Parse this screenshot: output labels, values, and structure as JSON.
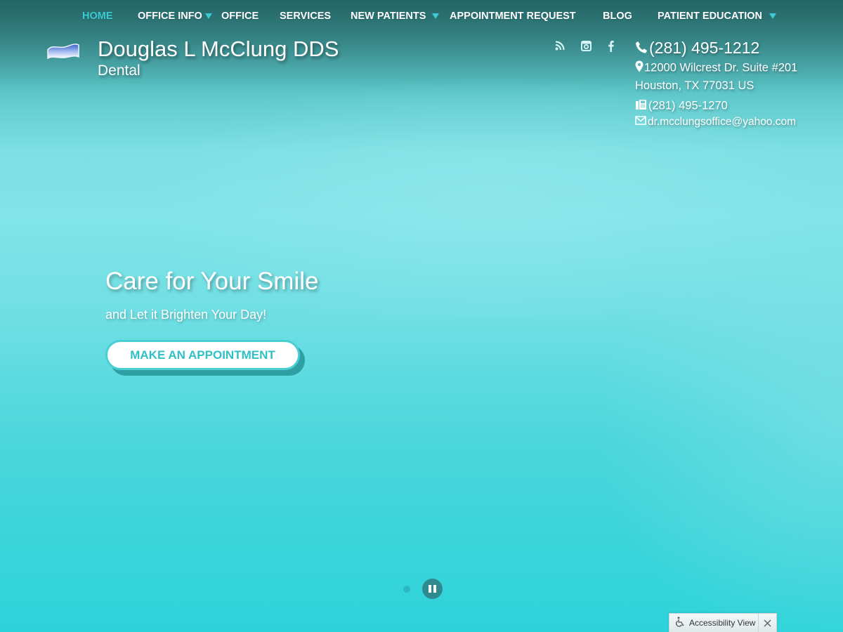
{
  "nav": {
    "items": [
      {
        "label": "HOME",
        "active": true,
        "has_dropdown": false
      },
      {
        "label": "OFFICE INFO",
        "active": false,
        "has_dropdown": true
      },
      {
        "label": "OFFICE",
        "active": false,
        "has_dropdown": false
      },
      {
        "label": "SERVICES",
        "active": false,
        "has_dropdown": false
      },
      {
        "label": "NEW PATIENTS",
        "active": false,
        "has_dropdown": true
      },
      {
        "label": "APPOINTMENT REQUEST",
        "active": false,
        "has_dropdown": false
      },
      {
        "label": "BLOG",
        "active": false,
        "has_dropdown": false
      },
      {
        "label": "PATIENT EDUCATION",
        "active": false,
        "has_dropdown": true
      }
    ]
  },
  "brand": {
    "logo_icon": "tooth-wave-logo",
    "name": "Douglas L McClung DDS",
    "subtitle": "Dental"
  },
  "social": [
    {
      "name": "rss-icon"
    },
    {
      "name": "instagram-icon"
    },
    {
      "name": "facebook-icon"
    }
  ],
  "contact": {
    "phone": "(281) 495-1212",
    "address_line1": "12000 Wilcrest Dr. Suite #201",
    "address_line2": "Houston, TX 77031 US",
    "fax": "(281) 495-1270",
    "email": "dr.mcclungsoffice@yahoo.com"
  },
  "hero": {
    "title": "Care for Your Smile",
    "subtitle": "and Let it Brighten Your Day!",
    "cta_label": "MAKE AN APPOINTMENT"
  },
  "slider": {
    "slide_count": 1,
    "current_slide": 1,
    "state": "playing"
  },
  "accessibility": {
    "label": "Accessibility View"
  },
  "colors": {
    "accent": "#3cc9d1",
    "cta_text": "#2fbfc7",
    "pause_button": "#2e8a8e"
  }
}
